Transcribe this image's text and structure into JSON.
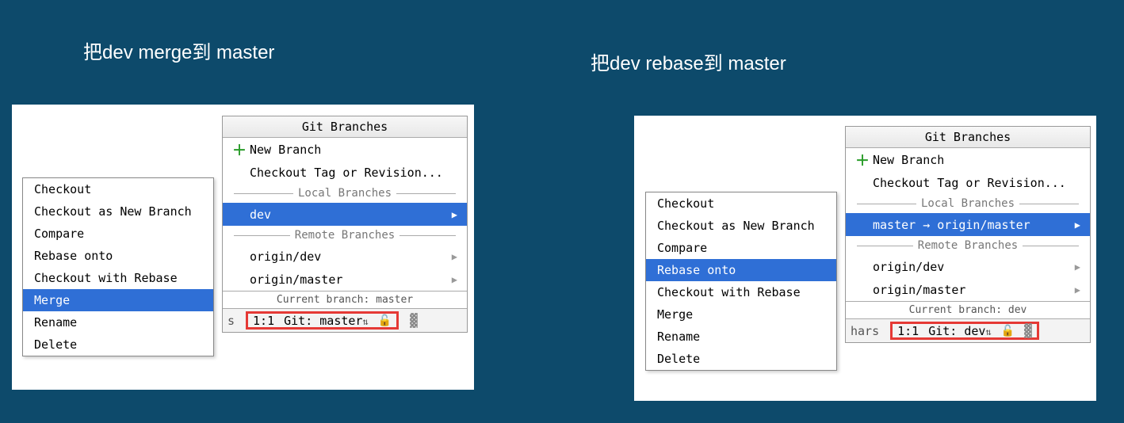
{
  "left": {
    "caption": "把dev merge到 master",
    "popup_title": "Git Branches",
    "new_branch": "New Branch",
    "checkout_tag": "Checkout Tag or Revision...",
    "local_branches_label": "Local Branches",
    "local_branch_selected": "dev",
    "remote_branches_label": "Remote Branches",
    "remote_branches": [
      "origin/dev",
      "origin/master"
    ],
    "current_branch_label": "Current branch: master",
    "status_pos": "1:1",
    "status_git": "Git: master",
    "context_menu": [
      "Checkout",
      "Checkout as New Branch",
      "Compare",
      "Rebase onto",
      "Checkout with Rebase",
      "Merge",
      "Rename",
      "Delete"
    ],
    "context_selected_index": 5
  },
  "right": {
    "caption": "把dev rebase到 master",
    "popup_title": "Git Branches",
    "new_branch": "New Branch",
    "checkout_tag": "Checkout Tag or Revision...",
    "local_branches_label": "Local Branches",
    "local_branch_selected": "master → origin/master",
    "remote_branches_label": "Remote Branches",
    "remote_branches": [
      "origin/dev",
      "origin/master"
    ],
    "current_branch_label": "Current branch: dev",
    "status_pos": "1:1",
    "status_git": "Git: dev",
    "status_chars": "hars",
    "context_menu": [
      "Checkout",
      "Checkout as New Branch",
      "Compare",
      "Rebase onto",
      "Checkout with Rebase",
      "Merge",
      "Rename",
      "Delete"
    ],
    "context_selected_index": 3
  }
}
